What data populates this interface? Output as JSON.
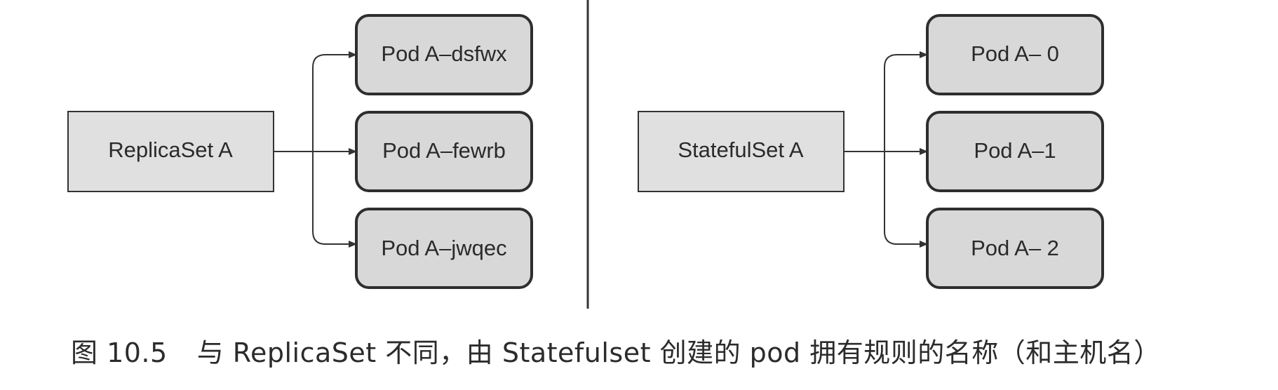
{
  "left_panel": {
    "controller_label": "ReplicaSet A",
    "pods": [
      "Pod A–dsfwx",
      "Pod A–fewrb",
      "Pod A–jwqec"
    ]
  },
  "right_panel": {
    "controller_label": "StatefulSet A",
    "pods": [
      "Pod A– 0",
      "Pod A–1",
      "Pod A– 2"
    ]
  },
  "caption": {
    "figure_number": "图 10.5",
    "text": "与 ReplicaSet 不同，由 Statefulset 创建的 pod 拥有规则的名称（和主机名）"
  },
  "colors": {
    "controller_fill": "#e0e0e0",
    "pod_fill": "#d8d8d8",
    "stroke": "#333333",
    "divider": "#333333"
  }
}
